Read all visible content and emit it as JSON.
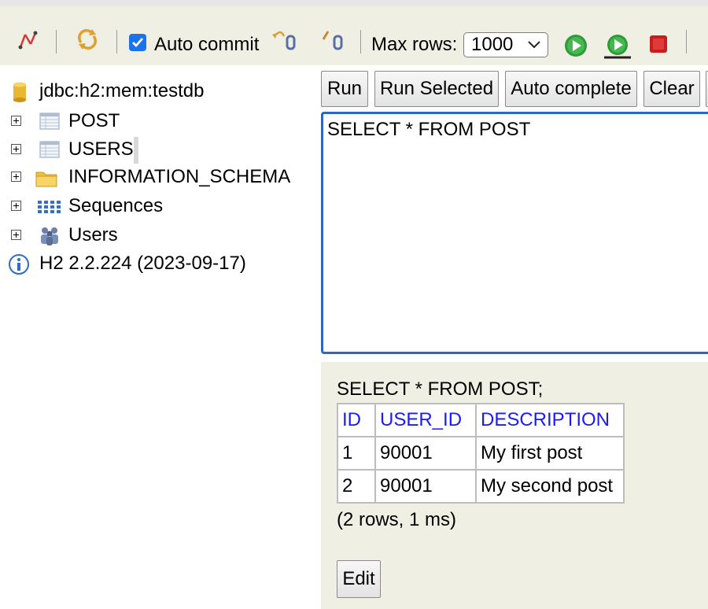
{
  "toolbar": {
    "auto_commit_label": "Auto commit",
    "auto_commit_checked": true,
    "max_rows_label": "Max rows:",
    "max_rows_value": "1000",
    "icons": [
      "disconnect-icon",
      "refresh-icon",
      "rollback-icon",
      "commit-icon",
      "run-icon",
      "run-selected-icon",
      "stop-icon"
    ]
  },
  "tree": {
    "connection": "jdbc:h2:mem:testdb",
    "items": [
      {
        "label": "POST",
        "icon": "table-icon"
      },
      {
        "label": "USERS",
        "icon": "table-icon"
      },
      {
        "label": "INFORMATION_SCHEMA",
        "icon": "folder-icon"
      },
      {
        "label": "Sequences",
        "icon": "sequences-icon"
      },
      {
        "label": "Users",
        "icon": "users-icon"
      }
    ],
    "version": "H2 2.2.224 (2023-09-17)"
  },
  "query": {
    "buttons": [
      "Run",
      "Run Selected",
      "Auto complete",
      "Clear"
    ],
    "sql": "SELECT * FROM POST"
  },
  "result": {
    "sql": "SELECT * FROM POST;",
    "columns": [
      "ID",
      "USER_ID",
      "DESCRIPTION"
    ],
    "rows": [
      [
        "1",
        "90001",
        "My first post"
      ],
      [
        "2",
        "90001",
        "My second post"
      ]
    ],
    "status": "(2 rows, 1 ms)",
    "edit_label": "Edit"
  },
  "colors": {
    "panel_bg": "#f0efe4",
    "editor_border": "#2f66c4",
    "header_text": "#1a1aff",
    "checkbox": "#1a73e8"
  }
}
